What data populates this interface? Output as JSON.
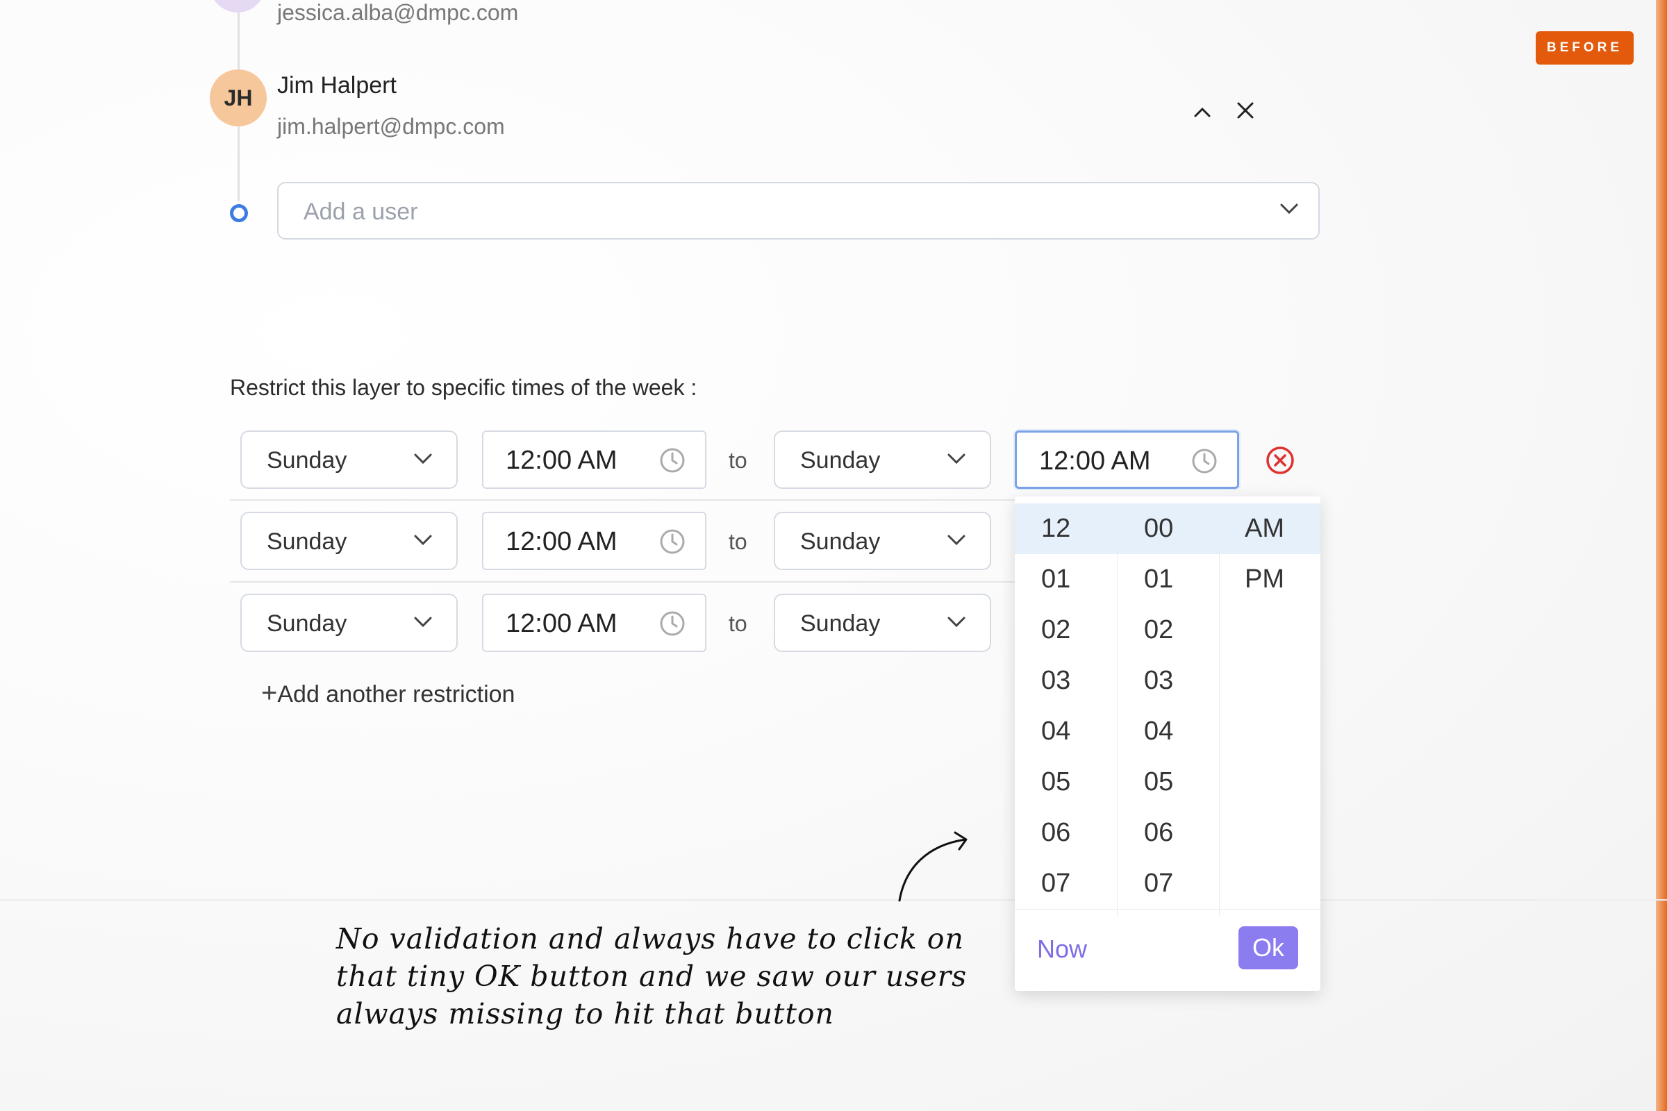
{
  "badge": "BEFORE",
  "users": [
    {
      "email": "jessica.alba@dmpc.com"
    },
    {
      "initials": "JH",
      "name": "Jim Halpert",
      "email": "jim.halpert@dmpc.com"
    }
  ],
  "add_user": {
    "placeholder": "Add a user"
  },
  "restrictions": {
    "label": "Restrict this layer to specific times of the week :",
    "connector": "to",
    "rows": [
      {
        "start_day": "Sunday",
        "start_time": "12:00 AM",
        "end_day": "Sunday",
        "end_time": "12:00 AM"
      },
      {
        "start_day": "Sunday",
        "start_time": "12:00 AM",
        "end_day": "Sunday"
      },
      {
        "start_day": "Sunday",
        "start_time": "12:00 AM",
        "end_day": "Sunday"
      }
    ],
    "add_label": "Add another restriction"
  },
  "picker": {
    "hours": [
      "12",
      "01",
      "02",
      "03",
      "04",
      "05",
      "06",
      "07"
    ],
    "minutes": [
      "00",
      "01",
      "02",
      "03",
      "04",
      "05",
      "06",
      "07"
    ],
    "periods": [
      "AM",
      "PM"
    ],
    "selected": {
      "hour": "12",
      "minute": "00",
      "period": "AM"
    },
    "now_label": "Now",
    "ok_label": "Ok"
  },
  "annotation": {
    "lines": [
      "No validation and always have to click on",
      "that tiny OK button and we saw our users",
      "always missing to hit that button"
    ]
  },
  "colors": {
    "accent": "#8b7cf0",
    "badge": "#e35a0c",
    "danger": "#e0312f",
    "timeline": "#3d7de0"
  },
  "icons": [
    "chevron-up-icon",
    "close-icon",
    "chevron-down-icon",
    "clock-icon",
    "remove-circle-icon",
    "plus-icon",
    "arrow-icon"
  ]
}
